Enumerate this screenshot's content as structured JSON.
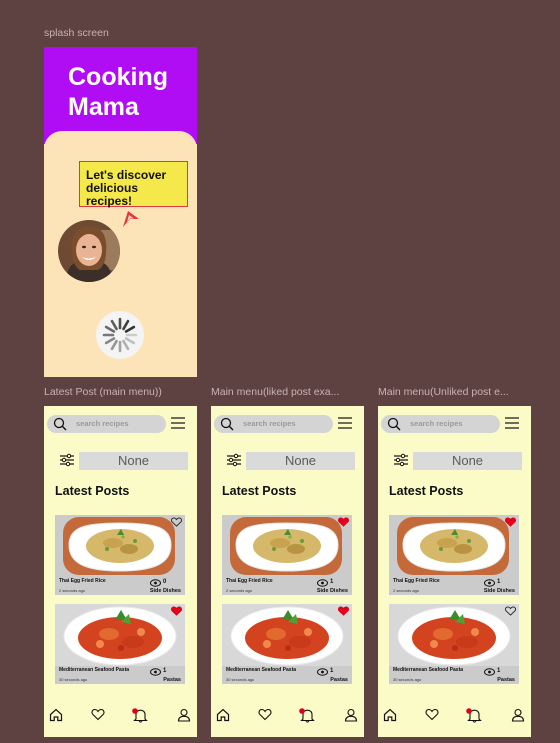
{
  "labels": {
    "splash": "splash screen",
    "latest": "Latest Post (main menu))",
    "liked": "Main menu(liked post exa...",
    "unliked": "Main menu(Unliked post e..."
  },
  "splash": {
    "title_line1": "Cooking",
    "title_line2": "Mama",
    "bubble_line1": "Let's discover",
    "bubble_line2": "delicious recipes!"
  },
  "screens": [
    {
      "search_placeholder": "search recipes",
      "filter_value": "None",
      "heading": "Latest Posts",
      "posts": [
        {
          "name": "Thai Egg Fried Rice",
          "time": "2 seconds ago",
          "views": "0",
          "category": "Side Dishes",
          "liked": false
        },
        {
          "name": "Mediterranean Seafood Pasta",
          "time": "30 seconds ago",
          "views": "1",
          "category": "Pastas",
          "liked": true
        }
      ]
    },
    {
      "search_placeholder": "search recipes",
      "filter_value": "None",
      "heading": "Latest Posts",
      "posts": [
        {
          "name": "Thai Egg Fried Rice",
          "time": "2 seconds ago",
          "views": "1",
          "category": "Side Dishes",
          "liked": true
        },
        {
          "name": "Mediterranean Seafood Pasta",
          "time": "30 seconds ago",
          "views": "1",
          "category": "Pastas",
          "liked": true
        }
      ]
    },
    {
      "search_placeholder": "search recipes",
      "filter_value": "None",
      "heading": "Latest Posts",
      "posts": [
        {
          "name": "Thai Egg Fried Rice",
          "time": "2 seconds ago",
          "views": "1",
          "category": "Side Dishes",
          "liked": true
        },
        {
          "name": "Mediterranean Seafood Pasta",
          "time": "30 seconds ago",
          "views": "1",
          "category": "Pastas",
          "liked": false
        }
      ]
    }
  ],
  "nav_icons": [
    "home-icon",
    "heart-icon",
    "bell-icon",
    "user-icon"
  ],
  "colors": {
    "background": "#5e4242",
    "splash_header": "#b10df5",
    "splash_body": "#fde4b8",
    "screen_bg": "#fbfbc8",
    "bubble": "#f4e84a",
    "like_red": "#e3001b"
  }
}
